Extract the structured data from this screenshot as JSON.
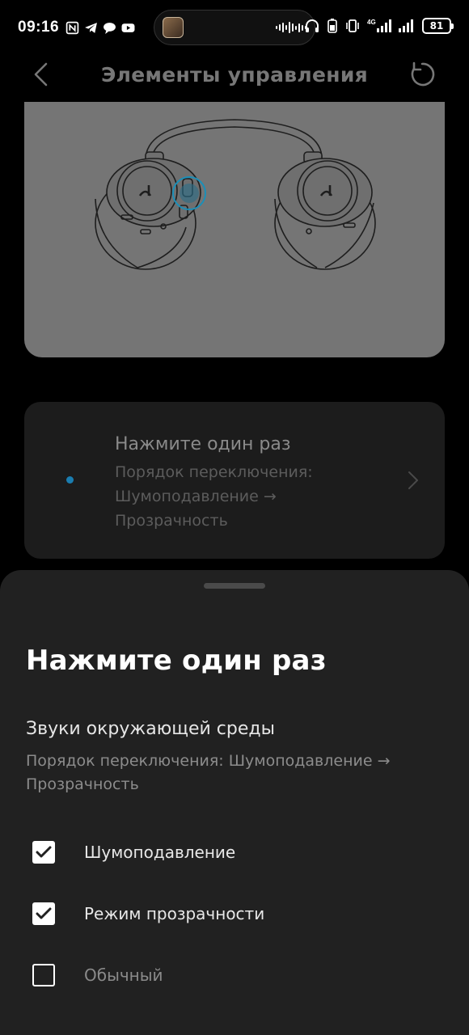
{
  "status_bar": {
    "time": "09:16",
    "battery": "81",
    "network_label": "4G"
  },
  "header": {
    "title": "Элементы управления"
  },
  "option_card": {
    "title": "Нажмите один раз",
    "subtitle": "Порядок переключения: Шумоподавление → Прозрачность"
  },
  "sheet": {
    "title": "Нажмите один раз",
    "section_title": "Звуки окружающей среды",
    "section_subtitle": "Порядок переключения: Шумоподавление → Прозрачность",
    "options": [
      {
        "label": "Шумоподавление",
        "checked": true
      },
      {
        "label": "Режим прозрачности",
        "checked": true
      },
      {
        "label": "Обычный",
        "checked": false
      }
    ]
  },
  "colors": {
    "accent_dot": "#1a7db0",
    "highlight_ring": "#1b8fb8",
    "sheet_bg": "#212121"
  }
}
